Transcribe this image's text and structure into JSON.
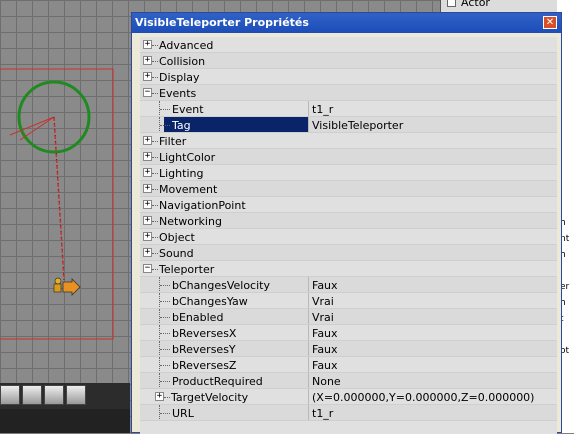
{
  "window": {
    "title": "VisibleTeleporter Propriétés",
    "close_icon": "close-icon"
  },
  "background": {
    "actor_label": "Actor",
    "side_text": [
      "h",
      "nt",
      "h",
      "er",
      "h",
      "t",
      "ot"
    ]
  },
  "properties": [
    {
      "name": "Advanced",
      "kind": "category",
      "expanded": false
    },
    {
      "name": "Collision",
      "kind": "category",
      "expanded": false
    },
    {
      "name": "Display",
      "kind": "category",
      "expanded": false
    },
    {
      "name": "Events",
      "kind": "category",
      "expanded": true
    },
    {
      "name": "Event",
      "kind": "property",
      "value": "t1_r"
    },
    {
      "name": "Tag",
      "kind": "property",
      "value": "VisibleTeleporter",
      "selected": true
    },
    {
      "name": "Filter",
      "kind": "category",
      "expanded": false
    },
    {
      "name": "LightColor",
      "kind": "category",
      "expanded": false
    },
    {
      "name": "Lighting",
      "kind": "category",
      "expanded": false
    },
    {
      "name": "Movement",
      "kind": "category",
      "expanded": false
    },
    {
      "name": "NavigationPoint",
      "kind": "category",
      "expanded": false
    },
    {
      "name": "Networking",
      "kind": "category",
      "expanded": false
    },
    {
      "name": "Object",
      "kind": "category",
      "expanded": false
    },
    {
      "name": "Sound",
      "kind": "category",
      "expanded": false
    },
    {
      "name": "Teleporter",
      "kind": "category",
      "expanded": true
    },
    {
      "name": "bChangesVelocity",
      "kind": "property",
      "value": "Faux"
    },
    {
      "name": "bChangesYaw",
      "kind": "property",
      "value": "Vrai"
    },
    {
      "name": "bEnabled",
      "kind": "property",
      "value": "Vrai"
    },
    {
      "name": "bReversesX",
      "kind": "property",
      "value": "Faux"
    },
    {
      "name": "bReversesY",
      "kind": "property",
      "value": "Faux"
    },
    {
      "name": "bReversesZ",
      "kind": "property",
      "value": "Faux"
    },
    {
      "name": "ProductRequired",
      "kind": "property",
      "value": "None"
    },
    {
      "name": "TargetVelocity",
      "kind": "subcategory",
      "value": "(X=0.000000,Y=0.000000,Z=0.000000)"
    },
    {
      "name": "URL",
      "kind": "property",
      "value": "t1_r"
    }
  ]
}
